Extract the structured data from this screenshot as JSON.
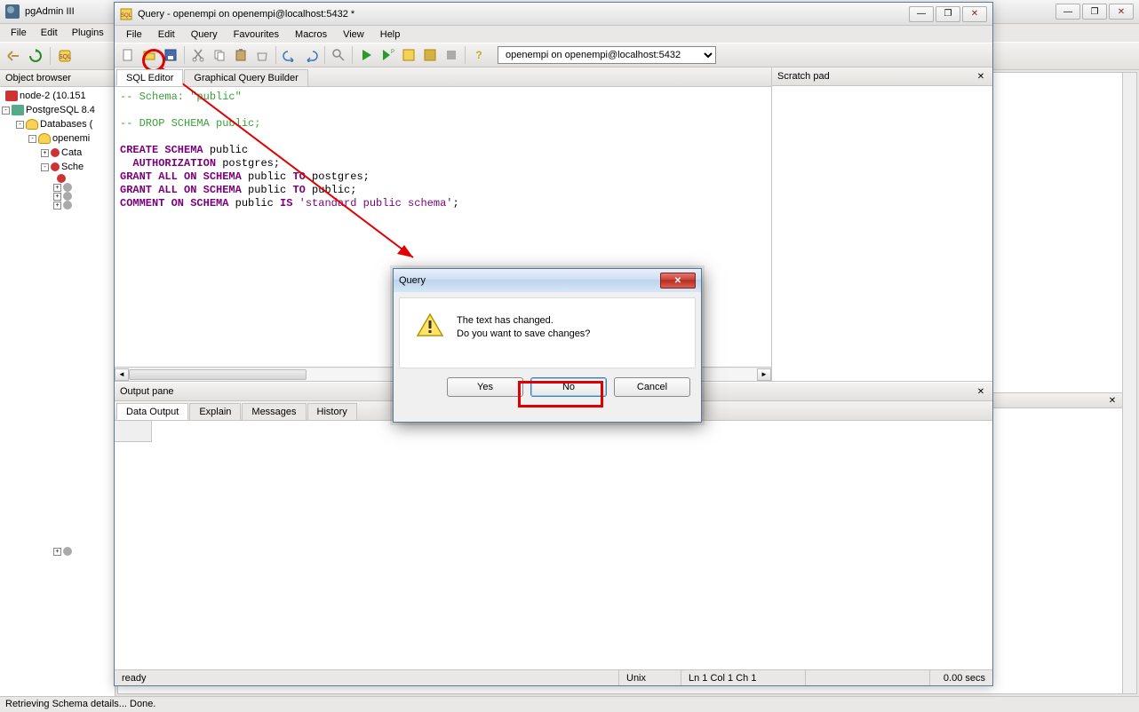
{
  "main": {
    "title": "pgAdmin III",
    "menus": [
      "File",
      "Edit",
      "Plugins"
    ],
    "object_browser_title": "Object browser",
    "tree": [
      {
        "indent": 0,
        "expand": "",
        "icon": "server-red",
        "label": "node-2 (10.151"
      },
      {
        "indent": 0,
        "expand": "-",
        "icon": "server-blue",
        "label": "PostgreSQL 8.4"
      },
      {
        "indent": 1,
        "expand": "-",
        "icon": "db",
        "label": "Databases ("
      },
      {
        "indent": 2,
        "expand": "-",
        "icon": "db",
        "label": "openemi"
      },
      {
        "indent": 3,
        "expand": "+",
        "icon": "node-red",
        "label": "Cata"
      },
      {
        "indent": 3,
        "expand": "-",
        "icon": "node-red",
        "label": "Sche"
      },
      {
        "indent": 4,
        "expand": "",
        "icon": "node-red",
        "label": ""
      },
      {
        "indent": 5,
        "expand": "",
        "icon": "",
        "label": ""
      },
      {
        "indent": 5,
        "expand": "",
        "icon": "",
        "label": ""
      },
      {
        "indent": 5,
        "expand": "",
        "icon": "",
        "label": ""
      },
      {
        "indent": 5,
        "expand": "",
        "icon": "",
        "label": ""
      },
      {
        "indent": 4,
        "expand": "+",
        "icon": "node-gray",
        "label": ""
      },
      {
        "indent": 4,
        "expand": "+",
        "icon": "node-gray",
        "label": ""
      },
      {
        "indent": 4,
        "expand": "+",
        "icon": "node-gray",
        "label": ""
      },
      {
        "indent": 4,
        "expand": "-",
        "icon": "node-gray",
        "label": ""
      }
    ],
    "statusbar": "Retrieving Schema details... Done."
  },
  "query": {
    "title": "Query - openempi on openempi@localhost:5432 *",
    "menus": [
      "File",
      "Edit",
      "Query",
      "Favourites",
      "Macros",
      "View",
      "Help"
    ],
    "connection": "openempi on openempi@localhost:5432",
    "tabs": {
      "sql": "SQL Editor",
      "gqb": "Graphical Query Builder"
    },
    "scratch": {
      "title": "Scratch pad"
    },
    "output": {
      "title": "Output pane",
      "tabs": [
        "Data Output",
        "Explain",
        "Messages",
        "History"
      ]
    },
    "status": {
      "ready": "ready",
      "enc": "Unix",
      "pos": "Ln 1 Col 1 Ch 1",
      "rows": "",
      "time": "0.00 secs"
    },
    "sql": {
      "l1a": "-- Schema: ",
      "l1b": "\"public\"",
      "l2": "",
      "l3": "-- DROP SCHEMA public;",
      "l4": "",
      "l5a": "CREATE SCHEMA",
      "l5b": " public",
      "l6a": "  AUTHORIZATION",
      "l6b": " postgres;",
      "l7a": "GRANT ALL ON SCHEMA",
      "l7b": " public ",
      "l7c": "TO",
      "l7d": " postgres;",
      "l8a": "GRANT ALL ON SCHEMA",
      "l8b": " public ",
      "l8c": "TO",
      "l8d": " public;",
      "l9a": "COMMENT ON SCHEMA",
      "l9b": " public ",
      "l9c": "IS",
      "l9d": " 'standard public schema'",
      "l9e": ";"
    }
  },
  "dialog": {
    "title": "Query",
    "msg1": "The text has changed.",
    "msg2": "Do you want to save changes?",
    "yes": "Yes",
    "no": "No",
    "cancel": "Cancel"
  }
}
